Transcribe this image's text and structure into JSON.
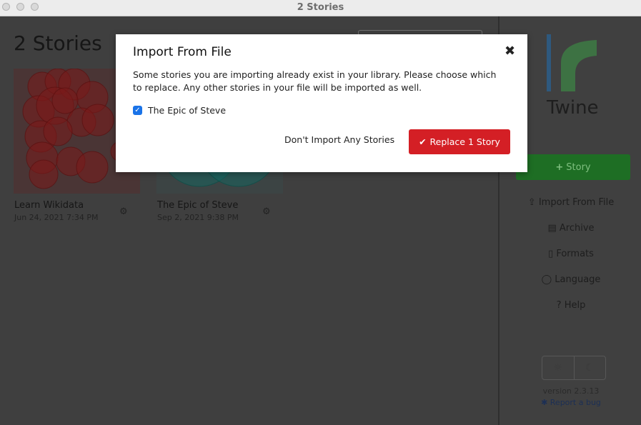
{
  "window": {
    "title": "2 Stories"
  },
  "library": {
    "page_title": "2 Stories",
    "stories": [
      {
        "title": "Learn Wikidata",
        "date": "Jun 24, 2021 7:34 PM",
        "settings_icon": "gear-icon"
      },
      {
        "title": "The Epic of Steve",
        "date": "Sep 2, 2021 9:38 PM",
        "settings_icon": "gear-icon"
      }
    ]
  },
  "sidebar": {
    "app_name": "Twine",
    "story_button": {
      "icon": "plus-icon",
      "label": "Story"
    },
    "items": [
      {
        "icon": "upload-icon",
        "label": "Import From File"
      },
      {
        "icon": "archive-icon",
        "label": "Archive"
      },
      {
        "icon": "file-code-icon",
        "label": "Formats"
      },
      {
        "icon": "comment-icon",
        "label": "Language"
      },
      {
        "icon": "question-circle-icon",
        "label": "Help"
      }
    ],
    "theme_options": [
      "sun-icon",
      "moon-icon"
    ],
    "version": "version 2.3.13",
    "report_bug": "Report a bug"
  },
  "dialog": {
    "title": "Import From File",
    "message": "Some stories you are importing already exist in your library. Please choose which to replace. Any other stories in your file will be imported as well.",
    "checkbox": {
      "label": "The Epic of Steve",
      "checked": true
    },
    "cancel_label": "Don't Import Any Stories",
    "confirm_label": "Replace 1 Story"
  },
  "colors": {
    "confirm": "#d41f25",
    "story_button": "#1e6e24",
    "checkbox": "#1a73e8",
    "logo_blue": "#1f6eb0",
    "logo_green": "#3a9a45"
  }
}
